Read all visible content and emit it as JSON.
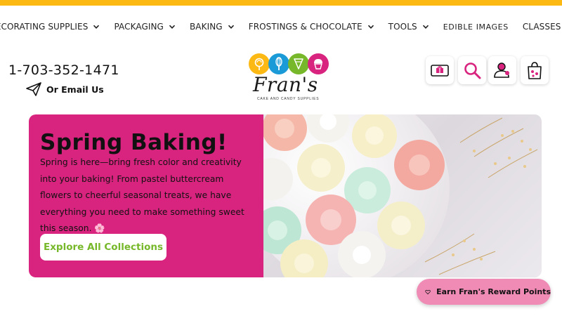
{
  "colors": {
    "accent_yellow": "#fcb813",
    "hero_pink": "#d8237f",
    "cta_green": "#76b82a",
    "reward_pink": "#f08bb6",
    "icon_pink": "#d8237f"
  },
  "nav": {
    "items": [
      {
        "label": "DECORATING SUPPLIES",
        "dropdown": true
      },
      {
        "label": "PACKAGING",
        "dropdown": true
      },
      {
        "label": "BAKING",
        "dropdown": true
      },
      {
        "label": "FROSTINGS & CHOCOLATE",
        "dropdown": true
      },
      {
        "label": "TOOLS",
        "dropdown": true
      },
      {
        "label": "EDIBLE IMAGES",
        "dropdown": false
      },
      {
        "label": "CLASSES",
        "dropdown": true
      }
    ]
  },
  "contact": {
    "phone": "1-703-352-1471",
    "email_label": "Or Email Us",
    "email_icon": "paper-plane-icon"
  },
  "logo": {
    "name": "Fran's",
    "tagline": "Cake and Candy Supplies"
  },
  "header_icons": [
    "gift-card-icon",
    "search-icon",
    "account-icon",
    "cart-icon"
  ],
  "hero": {
    "title": "Spring Baking!",
    "text": "Spring is here—bring fresh color and creativity into your baking! From pastel buttercream flowers to cheerful seasonal treats, we have everything you need to make something sweet this season. 🌸",
    "cta_label": "Explore All Collections"
  },
  "reward": {
    "label": "Earn Fran's Reward Points",
    "icon": "heart-icon"
  }
}
